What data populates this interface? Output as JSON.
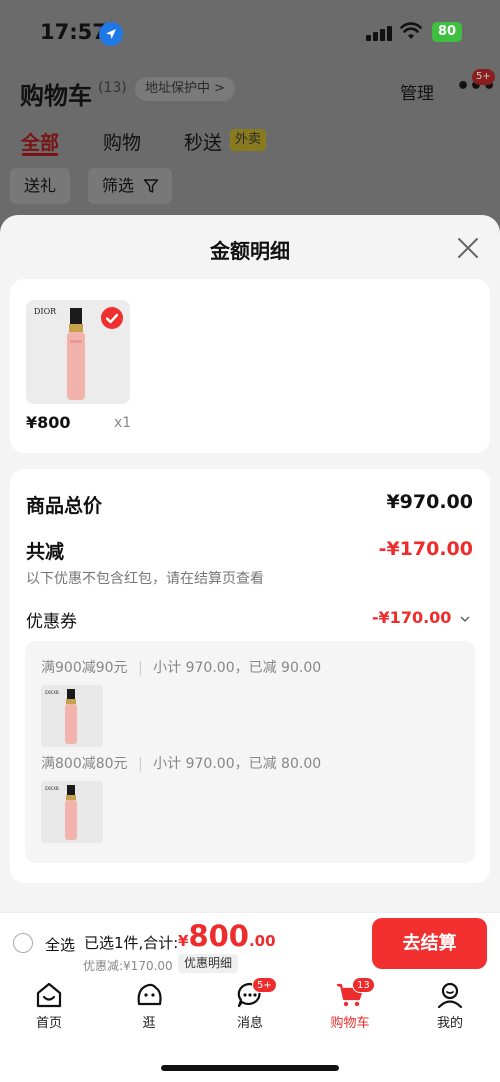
{
  "status_bar": {
    "time": "17:57",
    "battery": "80"
  },
  "header": {
    "title": "购物车",
    "count": "(13)",
    "address_protect": "地址保护中 >",
    "manage": "管理",
    "more_badge": "5+",
    "tabs": [
      "全部",
      "购物",
      "秒送"
    ],
    "takeout_tag": "外卖",
    "filters": [
      "送礼",
      "筛选"
    ]
  },
  "sheet": {
    "title": "金额明细",
    "product": {
      "price": "¥800",
      "qty": "x1",
      "brand": "DIOR"
    },
    "summary": {
      "total_label": "商品总价",
      "total_value": "¥970.00",
      "discount_label": "共减",
      "discount_value": "-¥170.00",
      "note": "以下优惠不包含红包，请在结算页查看",
      "coupon_label": "优惠券",
      "coupon_value": "-¥170.00"
    },
    "coupon_rules": [
      {
        "rule": "满900减90元",
        "detail": "小计 970.00，已减 90.00"
      },
      {
        "rule": "满800减80元",
        "detail": "小计 970.00，已减 80.00"
      }
    ]
  },
  "bottom_bar": {
    "select_all": "全选",
    "selected_summary": "已选1件,合计:",
    "total_currency": "¥",
    "total_int": "800",
    "total_dec": ".00",
    "discount_summary": "优惠减:¥170.00",
    "detail_chip": "优惠明细",
    "checkout": "去结算"
  },
  "tabbar": {
    "items": [
      {
        "label": "首页",
        "icon": "home-icon"
      },
      {
        "label": "逛",
        "icon": "browse-icon"
      },
      {
        "label": "消息",
        "icon": "message-icon",
        "badge": "5+"
      },
      {
        "label": "购物车",
        "icon": "cart-icon",
        "badge": "13",
        "active": true
      },
      {
        "label": "我的",
        "icon": "profile-icon"
      }
    ]
  },
  "colors": {
    "accent": "#ef2c2c",
    "overlay": "#6b6b6b",
    "sheet_bg": "#f4f4f4"
  }
}
